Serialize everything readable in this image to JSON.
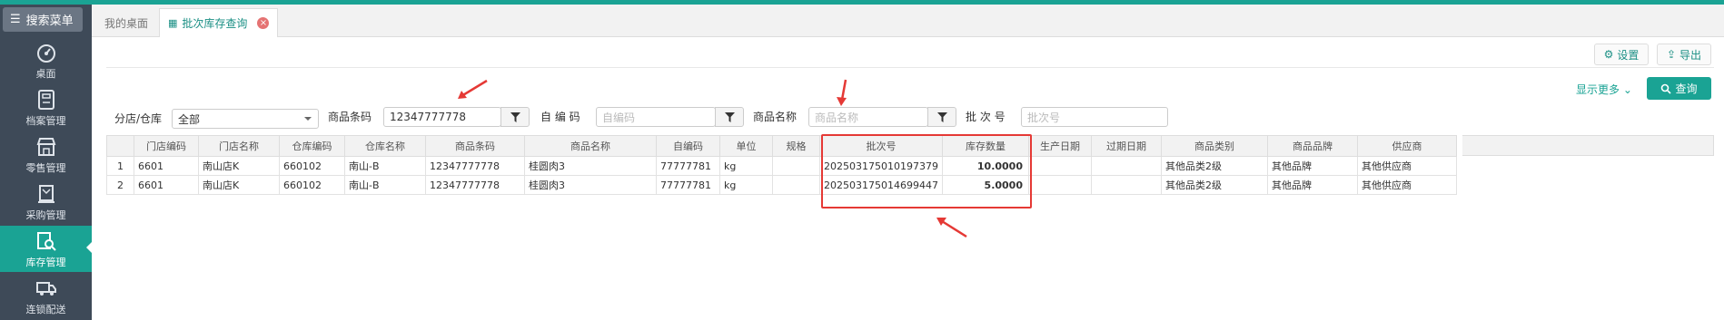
{
  "sidebar": {
    "search_label": "搜索菜单",
    "items": [
      {
        "label": "桌面",
        "icon": "dashboard-icon"
      },
      {
        "label": "档案管理",
        "icon": "archive-icon"
      },
      {
        "label": "零售管理",
        "icon": "store-icon"
      },
      {
        "label": "采购管理",
        "icon": "purchase-icon"
      },
      {
        "label": "库存管理",
        "icon": "inventory-search-icon",
        "active": true
      },
      {
        "label": "连锁配送",
        "icon": "truck-icon"
      }
    ]
  },
  "tabs": [
    {
      "label": "我的桌面"
    },
    {
      "label": "批次库存查询",
      "active": true
    }
  ],
  "toolbar": {
    "settings_label": "设置",
    "export_label": "导出",
    "more_label": "显示更多",
    "query_label": "查询"
  },
  "filters": {
    "store_label": "分店/仓库",
    "store_value": "全部",
    "barcode_label": "商品条码",
    "barcode_value": "12347777778",
    "selfcode_label": "自 编 码",
    "selfcode_placeholder": "自编码",
    "name_label": "商品名称",
    "name_placeholder": "商品名称",
    "batch_label": "批 次 号",
    "batch_placeholder": "批次号"
  },
  "table": {
    "columns": [
      "",
      "门店编码",
      "门店名称",
      "仓库编码",
      "仓库名称",
      "商品条码",
      "商品名称",
      "自编码",
      "单位",
      "规格",
      "批次号",
      "库存数量",
      "生产日期",
      "过期日期",
      "商品类别",
      "商品品牌",
      "供应商"
    ],
    "rows": [
      [
        "1",
        "6601",
        "南山店K",
        "660102",
        "南山-B",
        "12347777778",
        "桂圆肉3",
        "77777781",
        "kg",
        "",
        "202503175010197379",
        "10.0000",
        "",
        "",
        "其他品类2级",
        "其他品牌",
        "其他供应商"
      ],
      [
        "2",
        "6601",
        "南山店K",
        "660102",
        "南山-B",
        "12347777778",
        "桂圆肉3",
        "77777781",
        "kg",
        "",
        "202503175014699447",
        "5.0000",
        "",
        "",
        "其他品类2级",
        "其他品牌",
        "其他供应商"
      ]
    ]
  },
  "colors": {
    "accent": "#1aa394",
    "sidebar": "#3e4a58",
    "highlight": "#e53935"
  }
}
